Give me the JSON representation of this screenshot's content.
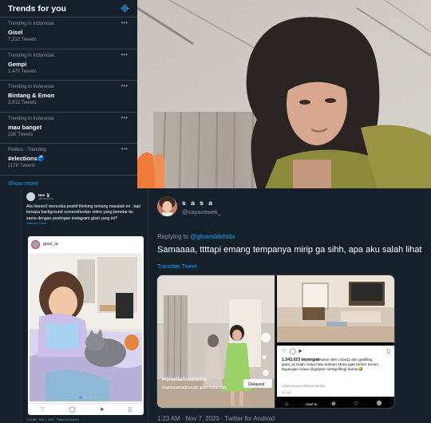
{
  "trends": {
    "title": "Trends for you",
    "items": [
      {
        "context": "Trending in Indonesia",
        "name": "Gisel",
        "count": "7,212 Tweets"
      },
      {
        "context": "Trending in Indonesia",
        "name": "Gempi",
        "count": "1,470 Tweets"
      },
      {
        "context": "Trending in Indonesia",
        "name": "Bintang & Emon",
        "count": "3,813 Tweets"
      },
      {
        "context": "Trending in Indonesia",
        "name": "mau banget",
        "count": "23K Tweets"
      },
      {
        "context": "Politics · Trending",
        "name": "#elections🗳️",
        "count": "117K Tweets"
      }
    ],
    "show_more": "Show more",
    "more_glyph": "•••"
  },
  "left_tweet": {
    "name": "Hee 🐰",
    "handle": "@heeachoo",
    "text": "Aku bener2 mencoba positif thinking tentang masalah ini , tapi kenapa background screenshootan video yang beredar itu sama dengan postingan instagram gisel yang ini?",
    "translate": "Translate Tweet",
    "instagram_user": "gisel_la",
    "footer": "1:03 AM · Nov 7, 2020 · Twitter for Android"
  },
  "right_tweet": {
    "name": "s a s a",
    "handle": "@sayacewek_",
    "reply_prefix": "Replying to",
    "reply_to": "@gliseraldehida",
    "text": "Samaaaa, ttttapi emang tempanya mirip ga sihh, apa aku salah lihat",
    "translate": "Translate Tweet",
    "footer": "1:23 AM · Nov 7, 2020 · Twitter for Android",
    "media": {
      "overlay_user": "#GiselIaAnastasia",
      "delayed": "Delayed",
      "views": "1.543.023 tayangan",
      "liked_by": "Disukai oleh vi.too11 dan gadiiling",
      "caption": "gisel_la Udah mulai halu fashion show ajak temen temen bayangan bawa @gofyter mengelilingi kamar🤣",
      "comments": "Lihat semua 299 komentar",
      "date": "21 Apr",
      "music": "#samasamadirumah gisel mulai halu",
      "bar_label": "nisel la"
    }
  },
  "colors": {
    "bg_dark": "#15202b",
    "accent": "#1da1f2",
    "muted": "#8899a6",
    "divider": "#38444d"
  }
}
